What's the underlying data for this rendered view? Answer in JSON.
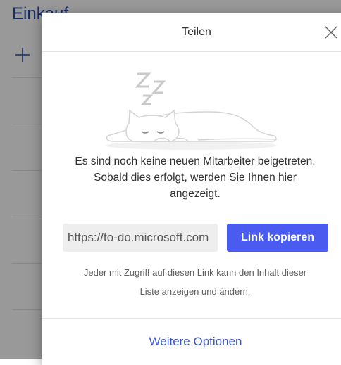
{
  "background": {
    "list_title": "Einkauf",
    "add_icon": "plus-icon"
  },
  "dialog": {
    "title": "Teilen",
    "close_icon": "close-icon",
    "illustration": {
      "description_icon": "sleeping-cat-icon",
      "sleep_letters": [
        "Z",
        "Z",
        "Z"
      ]
    },
    "message_lines": [
      "Es sind noch keine neuen Mitarbeiter beigetreten.",
      "Sobald dies erfolgt, werden Sie Ihnen hier",
      "angezeigt."
    ],
    "link_value": "https://to-do.microsoft.com",
    "copy_button_label": "Link kopieren",
    "info_lines": [
      "Jeder mit Zugriff auf diesen Link kann den Inhalt dieser",
      "Liste anzeigen und ändern."
    ],
    "more_options_label": "Weitere Optionen"
  },
  "colors": {
    "accent": "#4a5cf0",
    "link": "#3b58c4",
    "list_title": "#2b49a8"
  }
}
